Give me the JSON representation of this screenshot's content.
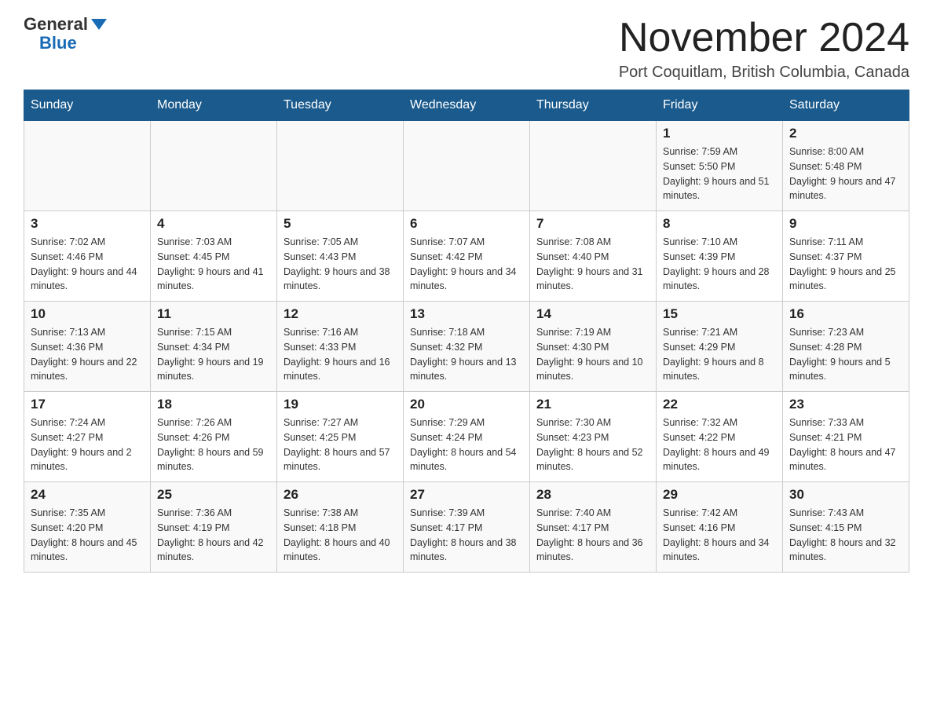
{
  "header": {
    "logo_general": "General",
    "logo_blue": "Blue",
    "title": "November 2024",
    "subtitle": "Port Coquitlam, British Columbia, Canada"
  },
  "days_of_week": [
    "Sunday",
    "Monday",
    "Tuesday",
    "Wednesday",
    "Thursday",
    "Friday",
    "Saturday"
  ],
  "weeks": [
    [
      {
        "day": "",
        "info": ""
      },
      {
        "day": "",
        "info": ""
      },
      {
        "day": "",
        "info": ""
      },
      {
        "day": "",
        "info": ""
      },
      {
        "day": "",
        "info": ""
      },
      {
        "day": "1",
        "info": "Sunrise: 7:59 AM\nSunset: 5:50 PM\nDaylight: 9 hours and 51 minutes."
      },
      {
        "day": "2",
        "info": "Sunrise: 8:00 AM\nSunset: 5:48 PM\nDaylight: 9 hours and 47 minutes."
      }
    ],
    [
      {
        "day": "3",
        "info": "Sunrise: 7:02 AM\nSunset: 4:46 PM\nDaylight: 9 hours and 44 minutes."
      },
      {
        "day": "4",
        "info": "Sunrise: 7:03 AM\nSunset: 4:45 PM\nDaylight: 9 hours and 41 minutes."
      },
      {
        "day": "5",
        "info": "Sunrise: 7:05 AM\nSunset: 4:43 PM\nDaylight: 9 hours and 38 minutes."
      },
      {
        "day": "6",
        "info": "Sunrise: 7:07 AM\nSunset: 4:42 PM\nDaylight: 9 hours and 34 minutes."
      },
      {
        "day": "7",
        "info": "Sunrise: 7:08 AM\nSunset: 4:40 PM\nDaylight: 9 hours and 31 minutes."
      },
      {
        "day": "8",
        "info": "Sunrise: 7:10 AM\nSunset: 4:39 PM\nDaylight: 9 hours and 28 minutes."
      },
      {
        "day": "9",
        "info": "Sunrise: 7:11 AM\nSunset: 4:37 PM\nDaylight: 9 hours and 25 minutes."
      }
    ],
    [
      {
        "day": "10",
        "info": "Sunrise: 7:13 AM\nSunset: 4:36 PM\nDaylight: 9 hours and 22 minutes."
      },
      {
        "day": "11",
        "info": "Sunrise: 7:15 AM\nSunset: 4:34 PM\nDaylight: 9 hours and 19 minutes."
      },
      {
        "day": "12",
        "info": "Sunrise: 7:16 AM\nSunset: 4:33 PM\nDaylight: 9 hours and 16 minutes."
      },
      {
        "day": "13",
        "info": "Sunrise: 7:18 AM\nSunset: 4:32 PM\nDaylight: 9 hours and 13 minutes."
      },
      {
        "day": "14",
        "info": "Sunrise: 7:19 AM\nSunset: 4:30 PM\nDaylight: 9 hours and 10 minutes."
      },
      {
        "day": "15",
        "info": "Sunrise: 7:21 AM\nSunset: 4:29 PM\nDaylight: 9 hours and 8 minutes."
      },
      {
        "day": "16",
        "info": "Sunrise: 7:23 AM\nSunset: 4:28 PM\nDaylight: 9 hours and 5 minutes."
      }
    ],
    [
      {
        "day": "17",
        "info": "Sunrise: 7:24 AM\nSunset: 4:27 PM\nDaylight: 9 hours and 2 minutes."
      },
      {
        "day": "18",
        "info": "Sunrise: 7:26 AM\nSunset: 4:26 PM\nDaylight: 8 hours and 59 minutes."
      },
      {
        "day": "19",
        "info": "Sunrise: 7:27 AM\nSunset: 4:25 PM\nDaylight: 8 hours and 57 minutes."
      },
      {
        "day": "20",
        "info": "Sunrise: 7:29 AM\nSunset: 4:24 PM\nDaylight: 8 hours and 54 minutes."
      },
      {
        "day": "21",
        "info": "Sunrise: 7:30 AM\nSunset: 4:23 PM\nDaylight: 8 hours and 52 minutes."
      },
      {
        "day": "22",
        "info": "Sunrise: 7:32 AM\nSunset: 4:22 PM\nDaylight: 8 hours and 49 minutes."
      },
      {
        "day": "23",
        "info": "Sunrise: 7:33 AM\nSunset: 4:21 PM\nDaylight: 8 hours and 47 minutes."
      }
    ],
    [
      {
        "day": "24",
        "info": "Sunrise: 7:35 AM\nSunset: 4:20 PM\nDaylight: 8 hours and 45 minutes."
      },
      {
        "day": "25",
        "info": "Sunrise: 7:36 AM\nSunset: 4:19 PM\nDaylight: 8 hours and 42 minutes."
      },
      {
        "day": "26",
        "info": "Sunrise: 7:38 AM\nSunset: 4:18 PM\nDaylight: 8 hours and 40 minutes."
      },
      {
        "day": "27",
        "info": "Sunrise: 7:39 AM\nSunset: 4:17 PM\nDaylight: 8 hours and 38 minutes."
      },
      {
        "day": "28",
        "info": "Sunrise: 7:40 AM\nSunset: 4:17 PM\nDaylight: 8 hours and 36 minutes."
      },
      {
        "day": "29",
        "info": "Sunrise: 7:42 AM\nSunset: 4:16 PM\nDaylight: 8 hours and 34 minutes."
      },
      {
        "day": "30",
        "info": "Sunrise: 7:43 AM\nSunset: 4:15 PM\nDaylight: 8 hours and 32 minutes."
      }
    ]
  ]
}
